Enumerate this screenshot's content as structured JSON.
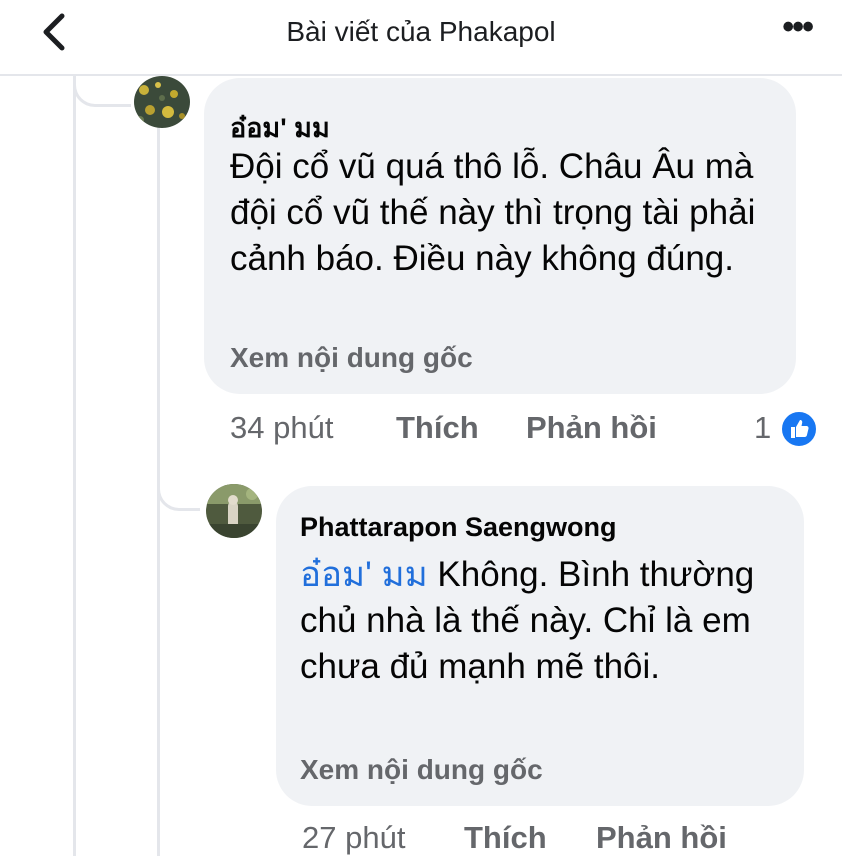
{
  "header": {
    "title": "Bài viết của Phakapol"
  },
  "comments": [
    {
      "author": "อ๋อม' มม",
      "text": "Đội cổ vũ quá thô lỗ. Châu Âu mà đội cổ vũ thế này thì trọng tài phải cảnh báo. Điều này không đúng.",
      "see_original": "Xem nội dung gốc",
      "time": "34 phút",
      "like_label": "Thích",
      "reply_label": "Phản hồi",
      "reaction_count": "1"
    },
    {
      "author": "Phattarapon Saengwong",
      "mention": "อ๋อม' มม",
      "text": " Không. Bình thường chủ nhà là thế này. Chỉ là em chưa đủ mạnh mẽ thôi.",
      "see_original": "Xem nội dung gốc",
      "time": "27 phút",
      "like_label": "Thích",
      "reply_label": "Phản hồi"
    }
  ],
  "icons": {
    "back": "chevron-left-icon",
    "more": "more-horizontal-icon",
    "reaction": "thumbs-up-icon"
  },
  "colors": {
    "accent": "#1877f2",
    "mention": "#216fdb",
    "secondary_text": "#65676b",
    "bubble": "#f0f2f5"
  }
}
